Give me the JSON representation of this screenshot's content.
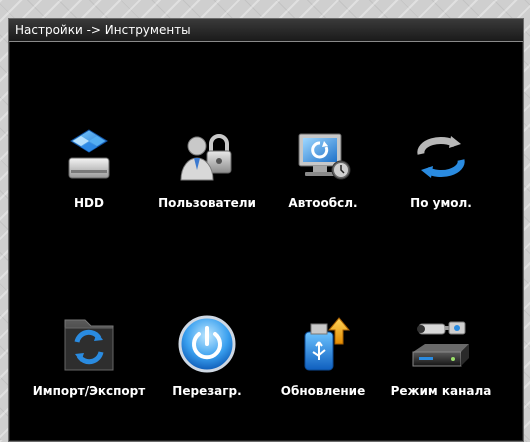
{
  "window": {
    "title": "Настройки -> Инструменты"
  },
  "tools": [
    {
      "label": "HDD",
      "icon": "hdd-icon"
    },
    {
      "label": "Пользователи",
      "icon": "users-lock-icon"
    },
    {
      "label": "Автообсл.",
      "icon": "auto-maintain-icon"
    },
    {
      "label": "По умол.",
      "icon": "restore-default-icon"
    },
    {
      "label": "Импорт/Экспорт",
      "icon": "import-export-icon"
    },
    {
      "label": "Перезагр.",
      "icon": "reboot-power-icon"
    },
    {
      "label": "Обновление",
      "icon": "upgrade-usb-icon"
    },
    {
      "label": "Режим канала",
      "icon": "channel-mode-icon"
    }
  ],
  "colors": {
    "background": "#000000",
    "title_text": "#ffffff",
    "label_text": "#ffffff",
    "accent_blue": "#2a8be0"
  }
}
